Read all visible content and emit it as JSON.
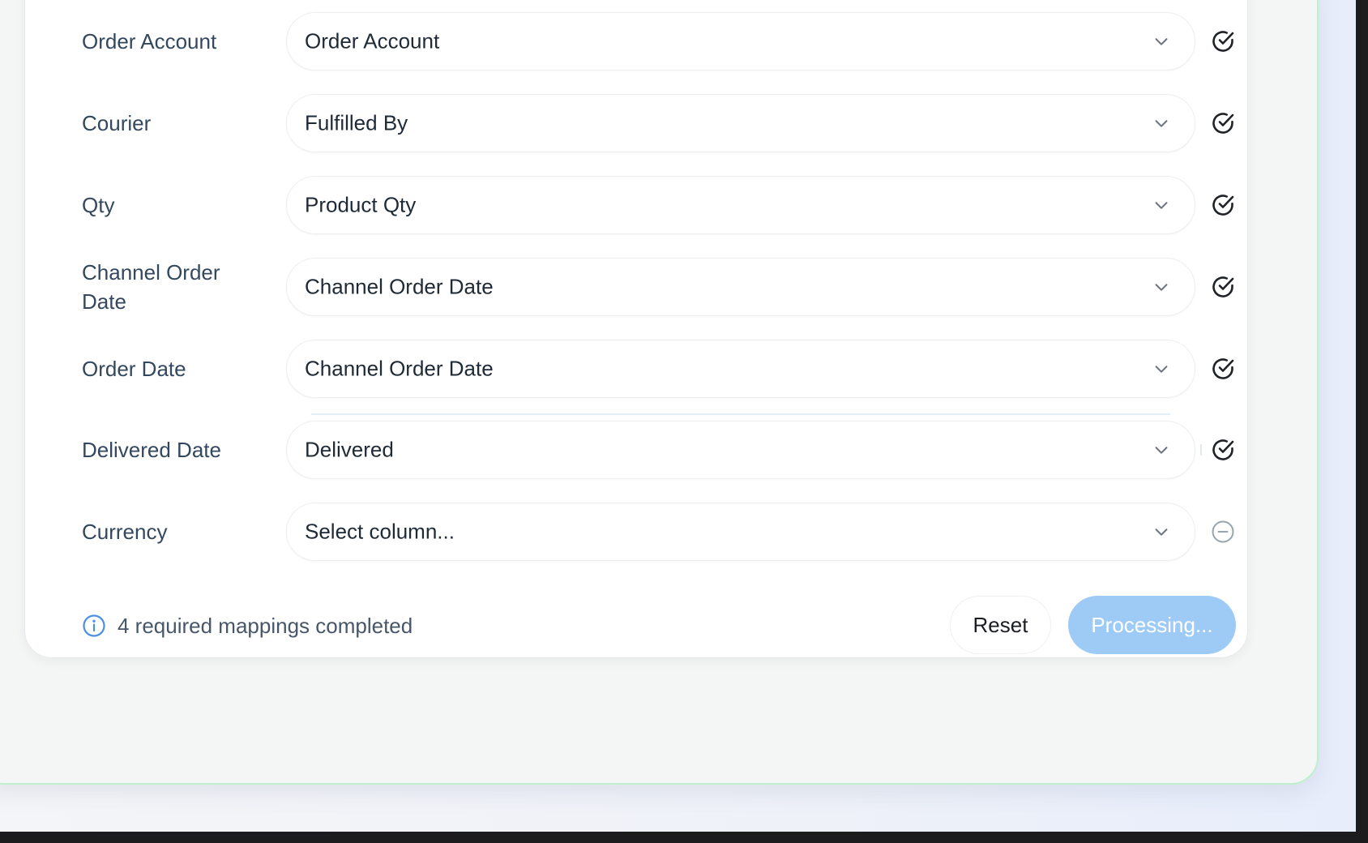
{
  "mappings": [
    {
      "label": "Order Account",
      "value": "Order Account",
      "status": "mapped",
      "status_icon": "check-circle-icon"
    },
    {
      "label": "Courier",
      "value": "Fulfilled By",
      "status": "mapped",
      "status_icon": "check-circle-icon"
    },
    {
      "label": "Qty",
      "value": "Product Qty",
      "status": "mapped",
      "status_icon": "check-circle-icon"
    },
    {
      "label": "Channel Order Date",
      "value": "Channel Order Date",
      "status": "mapped",
      "status_icon": "check-circle-icon"
    },
    {
      "label": "Order Date",
      "value": "Channel Order Date",
      "status": "mapped",
      "status_icon": "check-circle-icon"
    },
    {
      "label": "Delivered Date",
      "value": "Delivered",
      "status": "mapped",
      "status_icon": "check-circle-icon"
    },
    {
      "label": "Currency",
      "value": "Select column...",
      "status": "unmapped",
      "status_icon": "minus-circle-icon"
    }
  ],
  "footer": {
    "info_icon": "info-circle-icon",
    "info_text": "4 required mappings completed",
    "reset_label": "Reset",
    "primary_label": "Processing..."
  },
  "colors": {
    "accent": "#4a90e2",
    "primary_button_disabled": "#9ecbf6",
    "check_icon": "#1f2328",
    "unmapped_icon": "#9aa4ae",
    "panel_border": "#bff0cc"
  }
}
